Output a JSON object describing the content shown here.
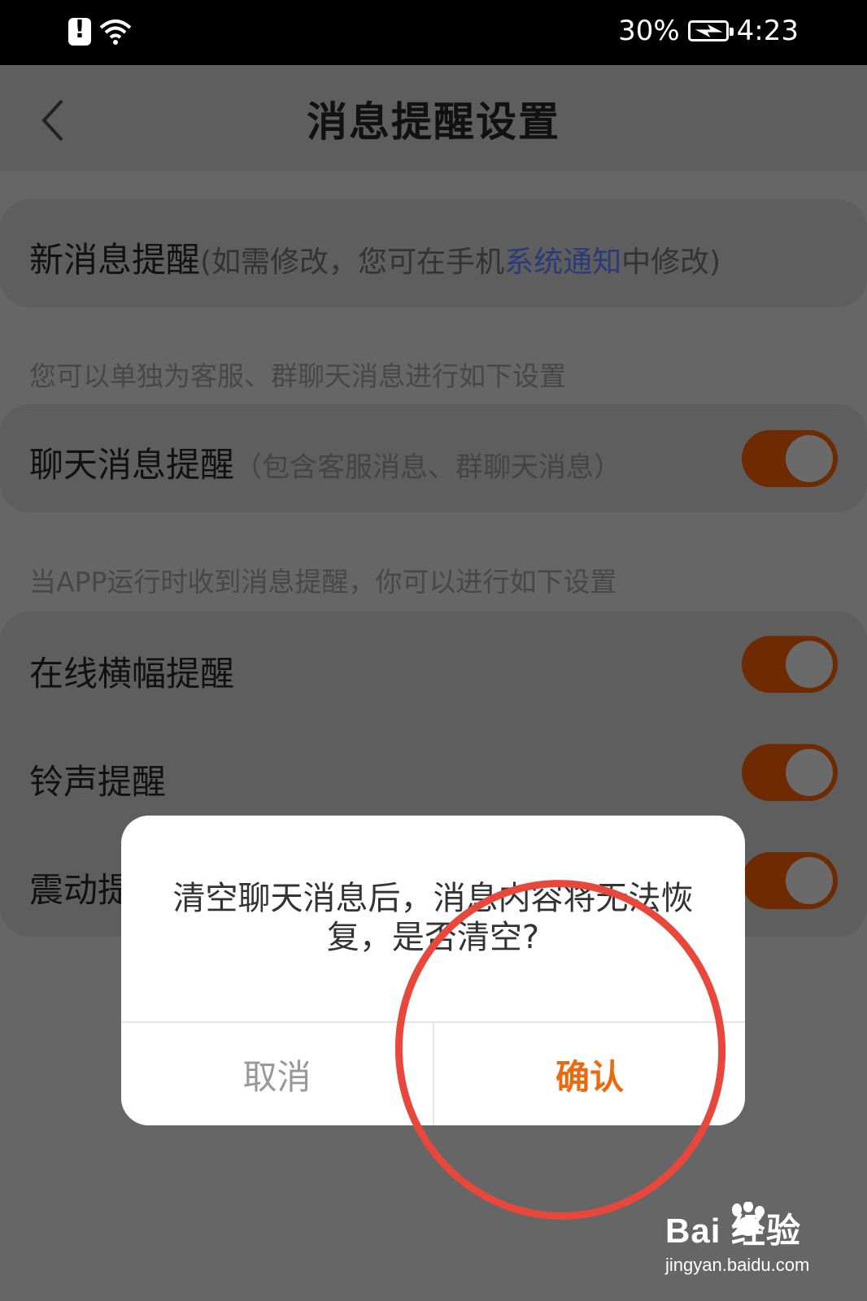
{
  "status_bar": {
    "battery": "30%",
    "time": "4:23"
  },
  "header": {
    "title": "消息提醒设置"
  },
  "new_message": {
    "label": "新消息提醒",
    "hint_prefix": "(如需修改，您可在手机",
    "hint_link": "系统通知",
    "hint_suffix": "中修改)"
  },
  "section1_note": "您可以单独为客服、群聊天消息进行如下设置",
  "chat_reminder": {
    "label": "聊天消息提醒",
    "hint": "（包含客服消息、群聊天消息）",
    "enabled": true
  },
  "section2_note": "当APP运行时收到消息提醒，你可以进行如下设置",
  "toggles": [
    {
      "label": "在线横幅提醒",
      "enabled": true
    },
    {
      "label": "铃声提醒",
      "enabled": true
    },
    {
      "label": "震动提",
      "enabled": true
    }
  ],
  "dialog": {
    "message": "清空聊天消息后，消息内容将无法恢复，是否清空?",
    "cancel": "取消",
    "confirm": "确认"
  },
  "watermark": {
    "brand": "Bai 经验",
    "url": "jingyan.baidu.com"
  },
  "colors": {
    "accent": "#ea6a10",
    "toggle_on": "#6e2a00",
    "link": "#2b3a78",
    "annotation_circle": "#e8483c"
  }
}
